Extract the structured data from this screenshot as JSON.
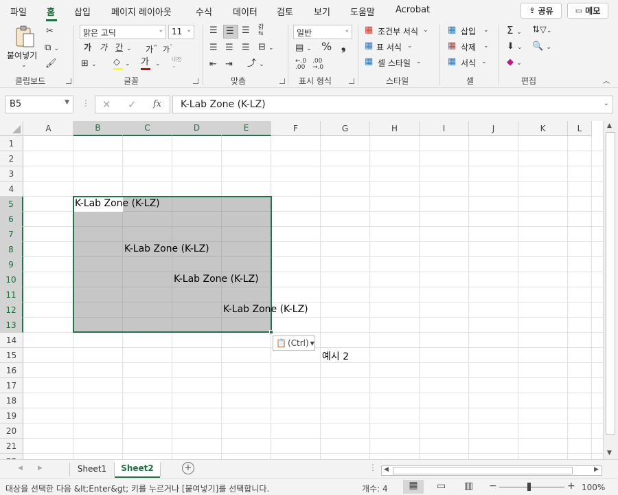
{
  "menu": {
    "tabs": [
      "파일",
      "홈",
      "삽입",
      "페이지 레이아웃",
      "수식",
      "데이터",
      "검토",
      "보기",
      "도움말",
      "Acrobat"
    ],
    "active_tab": "홈",
    "share_label": "공유",
    "memo_label": "메모"
  },
  "ribbon": {
    "clipboard": {
      "paste_label": "붙여넣기",
      "group_label": "클립보드"
    },
    "font": {
      "font_name": "맑은 고딕",
      "font_size": "11",
      "group_label": "글꼴",
      "bold": "가",
      "italic": "가",
      "underline": "간",
      "grow": "가",
      "shrink": "가",
      "phonetic": "내천",
      "font_color_glyph": "가"
    },
    "alignment": {
      "group_label": "맞춤",
      "wrap_glyph": "갉"
    },
    "number": {
      "format": "일반",
      "group_label": "표시 형식",
      "percent": "%",
      "comma": "❟"
    },
    "styles": {
      "conditional": "조건부 서식",
      "table": "표 서식",
      "cell": "셀 스타일",
      "group_label": "스타일"
    },
    "cells": {
      "insert": "삽입",
      "delete": "삭제",
      "format": "서식",
      "group_label": "셀"
    },
    "editing": {
      "group_label": "편집"
    }
  },
  "formula_bar": {
    "name_box": "B5",
    "fx": "fx",
    "content": "K-Lab Zone (K-LZ)"
  },
  "grid": {
    "columns": [
      "A",
      "B",
      "C",
      "D",
      "E",
      "F",
      "G",
      "H",
      "I",
      "J",
      "K",
      "L"
    ],
    "selected_columns": [
      "B",
      "C",
      "D",
      "E"
    ],
    "rows": [
      "1",
      "2",
      "3",
      "4",
      "5",
      "6",
      "7",
      "8",
      "9",
      "10",
      "11",
      "12",
      "13",
      "14",
      "15",
      "16",
      "17",
      "18",
      "19",
      "20",
      "21",
      "22"
    ],
    "selected_rows": [
      "5",
      "6",
      "7",
      "8",
      "9",
      "10",
      "11",
      "12",
      "13"
    ],
    "cells": {
      "B5": "K-Lab Zone (K-LZ)",
      "C8": "K-Lab Zone (K-LZ)",
      "D10": "K-Lab Zone (K-LZ)",
      "E12": "K-Lab Zone (K-LZ)",
      "G15": "예시 2"
    },
    "paste_options_label": "(Ctrl)"
  },
  "sheets": {
    "tabs": [
      "Sheet1",
      "Sheet2"
    ],
    "active": "Sheet2",
    "accent_color": "#217346"
  },
  "status": {
    "message": "대상을 선택한 다음 &lt;Enter&gt; 키를 누르거나 [붙여넣기]를 선택합니다.",
    "count": "개수: 4",
    "zoom": "100%"
  }
}
